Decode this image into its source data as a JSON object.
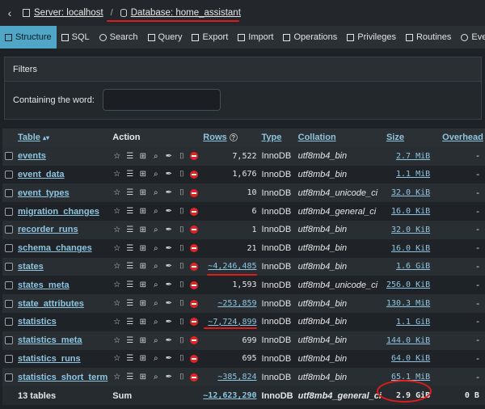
{
  "breadcrumb": {
    "server": "Server: localhost",
    "separator": "/",
    "database": "Database: home_assistant"
  },
  "tabs": [
    {
      "label": "Structure",
      "icon": "structure-icon"
    },
    {
      "label": "SQL",
      "icon": "sql-icon"
    },
    {
      "label": "Search",
      "icon": "search-icon"
    },
    {
      "label": "Query",
      "icon": "query-icon"
    },
    {
      "label": "Export",
      "icon": "export-icon"
    },
    {
      "label": "Import",
      "icon": "import-icon"
    },
    {
      "label": "Operations",
      "icon": "operations-icon"
    },
    {
      "label": "Privileges",
      "icon": "privileges-icon"
    },
    {
      "label": "Routines",
      "icon": "routines-icon"
    },
    {
      "label": "Events",
      "icon": "events-icon"
    }
  ],
  "filters": {
    "title": "Filters",
    "label": "Containing the word:",
    "value": ""
  },
  "table": {
    "headers": {
      "table": "Table",
      "action": "Action",
      "rows": "Rows",
      "type": "Type",
      "collation": "Collation",
      "size": "Size",
      "overhead": "Overhead"
    },
    "rows": [
      {
        "name": "events",
        "rows": "7,522",
        "type": "InnoDB",
        "collation": "utf8mb4_bin",
        "size": "2.7 MiB",
        "overhead": "-"
      },
      {
        "name": "event_data",
        "rows": "1,676",
        "type": "InnoDB",
        "collation": "utf8mb4_bin",
        "size": "1.1 MiB",
        "overhead": "-"
      },
      {
        "name": "event_types",
        "rows": "10",
        "type": "InnoDB",
        "collation": "utf8mb4_unicode_ci",
        "size": "32.0 KiB",
        "overhead": "-"
      },
      {
        "name": "migration_changes",
        "rows": "6",
        "type": "InnoDB",
        "collation": "utf8mb4_general_ci",
        "size": "16.0 KiB",
        "overhead": "-"
      },
      {
        "name": "recorder_runs",
        "rows": "1",
        "type": "InnoDB",
        "collation": "utf8mb4_bin",
        "size": "32.0 KiB",
        "overhead": "-"
      },
      {
        "name": "schema_changes",
        "rows": "21",
        "type": "InnoDB",
        "collation": "utf8mb4_bin",
        "size": "16.0 KiB",
        "overhead": "-"
      },
      {
        "name": "states",
        "rows": "~4,246,485",
        "type": "InnoDB",
        "collation": "utf8mb4_bin",
        "size": "1.6 GiB",
        "overhead": "-"
      },
      {
        "name": "states_meta",
        "rows": "1,593",
        "type": "InnoDB",
        "collation": "utf8mb4_unicode_ci",
        "size": "256.0 KiB",
        "overhead": "-"
      },
      {
        "name": "state_attributes",
        "rows": "~253,859",
        "type": "InnoDB",
        "collation": "utf8mb4_bin",
        "size": "130.3 MiB",
        "overhead": "-"
      },
      {
        "name": "statistics",
        "rows": "~7,724,899",
        "type": "InnoDB",
        "collation": "utf8mb4_bin",
        "size": "1.1 GiB",
        "overhead": "-"
      },
      {
        "name": "statistics_meta",
        "rows": "699",
        "type": "InnoDB",
        "collation": "utf8mb4_bin",
        "size": "144.0 KiB",
        "overhead": "-"
      },
      {
        "name": "statistics_runs",
        "rows": "695",
        "type": "InnoDB",
        "collation": "utf8mb4_bin",
        "size": "64.0 KiB",
        "overhead": "-"
      },
      {
        "name": "statistics_short_term",
        "rows": "~385,824",
        "type": "InnoDB",
        "collation": "utf8mb4_bin",
        "size": "65.1 MiB",
        "overhead": "-"
      }
    ],
    "footer": {
      "count": "13 tables",
      "sum": "Sum",
      "rows": "~12,623,290",
      "type": "InnoDB",
      "collation": "utf8mb4_general_ci",
      "size": "2.9 GiB",
      "overhead": "0 B"
    }
  },
  "colors": {
    "accent": "#4fa6c6",
    "link": "#8ec5e0",
    "annotation": "#e11a1a",
    "delete": "#e02424"
  }
}
